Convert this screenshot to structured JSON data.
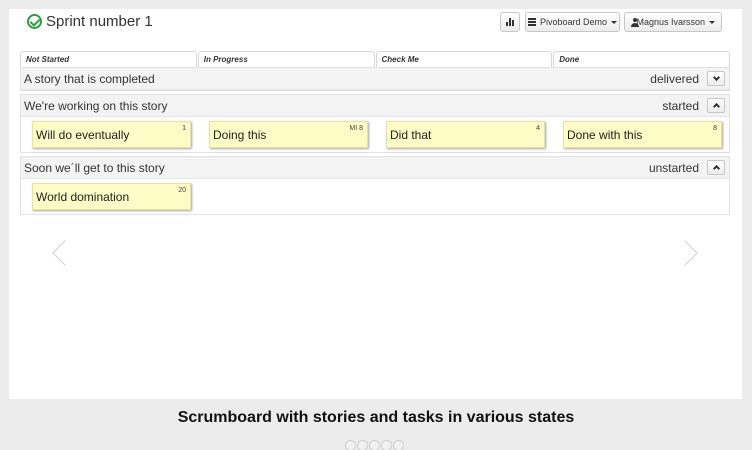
{
  "header": {
    "title": "Sprint number 1",
    "board_menu_label": "Pivoboard Demo",
    "user_menu_label": "Magnus Ivarsson",
    "icons": {
      "status": "check-circle-icon",
      "chart": "bar-chart-icon",
      "board": "list-icon",
      "user": "user-icon"
    }
  },
  "columns": [
    "Not Started",
    "In Progress",
    "Check Me",
    "Done"
  ],
  "stories": [
    {
      "title": "A story that is completed",
      "state": "delivered",
      "expanded": false,
      "tasks": []
    },
    {
      "title": "We're working on this story",
      "state": "started",
      "expanded": true,
      "tasks": [
        {
          "column": 0,
          "name": "Will do eventually",
          "points": "1"
        },
        {
          "column": 1,
          "name": "Doing this",
          "points": "MI 8"
        },
        {
          "column": 2,
          "name": "Did that",
          "points": "4"
        },
        {
          "column": 3,
          "name": "Done with this",
          "points": "8"
        }
      ]
    },
    {
      "title": "Soon we´ll get to this story",
      "state": "unstarted",
      "expanded": true,
      "tasks": [
        {
          "column": 0,
          "name": "World domination",
          "points": "20"
        }
      ]
    }
  ],
  "caption": "Scrumboard with stories and tasks in various states",
  "colors": {
    "task_background": "#fdfbc6",
    "status_icon": "#2e9e3e",
    "story_header": "#f3f3f3"
  }
}
